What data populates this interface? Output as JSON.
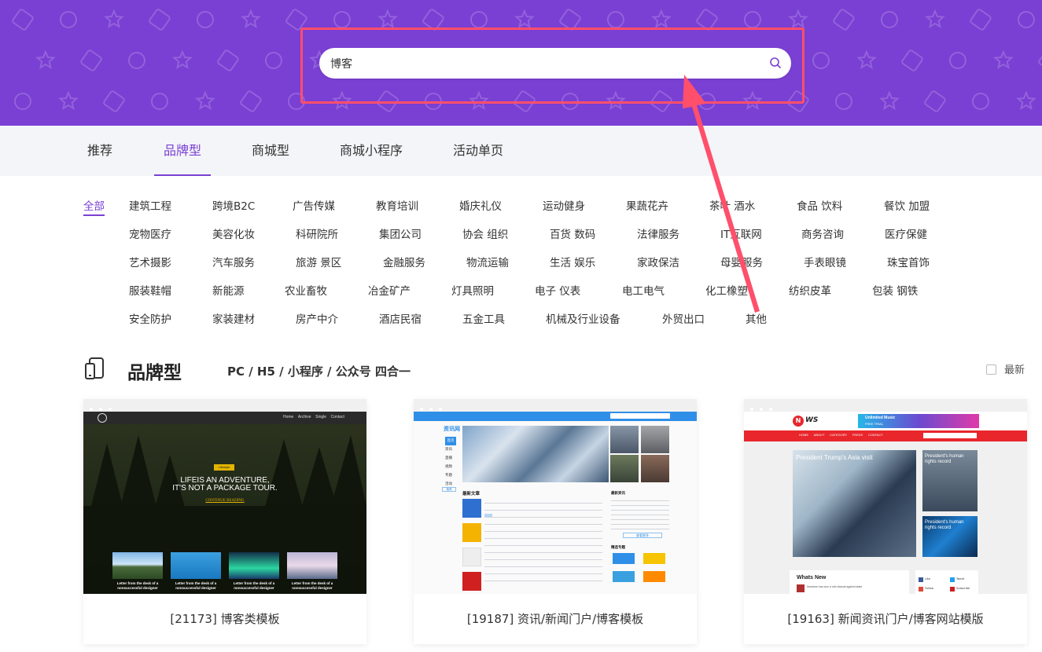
{
  "search": {
    "value": "博客"
  },
  "tabs": [
    {
      "label": "推荐",
      "active": false
    },
    {
      "label": "品牌型",
      "active": true
    },
    {
      "label": "商城型",
      "active": false
    },
    {
      "label": "商城小程序",
      "active": false
    },
    {
      "label": "活动单页",
      "active": false
    }
  ],
  "categories": {
    "all": "全部",
    "rows": [
      [
        "建筑工程",
        "跨境B2C",
        "广告传媒",
        "教育培训",
        "婚庆礼仪",
        "运动健身",
        "果蔬花卉",
        "茶叶 酒水",
        "食品 饮料",
        "餐饮 加盟"
      ],
      [
        "宠物医疗",
        "美容化妆",
        "科研院所",
        "集团公司",
        "协会 组织",
        "百货 数码",
        "法律服务",
        "IT互联网",
        "商务咨询",
        "医疗保健"
      ],
      [
        "艺术摄影",
        "汽车服务",
        "旅游 景区",
        "金融服务",
        "物流运输",
        "生活 娱乐",
        "家政保洁",
        "母婴服务",
        "手表眼镜",
        "珠宝首饰"
      ],
      [
        "服装鞋帽",
        "新能源",
        "农业畜牧",
        "冶金矿产",
        "灯具照明",
        "电子 仪表",
        "电工电气",
        "化工橡塑",
        "纺织皮革",
        "包装 钢铁"
      ],
      [
        "安全防护",
        "家装建材",
        "房产中介",
        "酒店民宿",
        "五金工具",
        "机械及行业设备",
        "外贸出口",
        "其他"
      ]
    ]
  },
  "section": {
    "title": "品牌型",
    "subtitle": "PC / H5 / 小程序 / 公众号 四合一",
    "latest_label": "最新"
  },
  "cards": [
    {
      "caption": "[21173] 博客类模板",
      "preview": {
        "nav": [
          "Home",
          "Archive",
          "Single",
          "Contact"
        ],
        "badge": "Lifestyle",
        "headline_1": "LIFEIS AN ADVENTURE,",
        "headline_2": "IT'S NOT A PACKAGE TOUR.",
        "link": "CONTINUE READING",
        "thumb_caption_1": "Letter from the desk of a",
        "thumb_caption_2": "nonsuccessful designer"
      }
    },
    {
      "caption": "[19187] 资讯/新闻门户/博客模板",
      "preview": {
        "logo": "资讯网",
        "sidebar": [
          "首页",
          "资讯",
          "直播",
          "视频",
          "专题",
          "活动"
        ],
        "section_latest": "最新文章",
        "section_news": "最新资讯",
        "section_topics": "精选专题",
        "more": "查看更多",
        "tag": "推荐"
      }
    },
    {
      "caption": "[19163] 新闻资讯门户/博客网站模版",
      "preview": {
        "logo_mark": "N",
        "logo_text": "WS",
        "banner_text": "Unlimited Music",
        "banner_sub": "FREE TRIAL",
        "nav": [
          "HOME",
          "ABOUT",
          "CATEGORY",
          "FEEDS",
          "CONTACT"
        ],
        "hero_text": "President Trump's Asia visit",
        "side_text_1": "President's human rights record",
        "side_text_2": "President's human rights record",
        "whats_new": "Whats New",
        "whats_new_item": "Nominee has won a rain lawsuit against state",
        "social": [
          "Like",
          "Tweet",
          "Follow",
          "Subscribe"
        ]
      }
    }
  ],
  "colors": {
    "hero_bg": "#7a3fd3",
    "accent": "#7a3fd3",
    "annotation": "#ff4f6b"
  }
}
